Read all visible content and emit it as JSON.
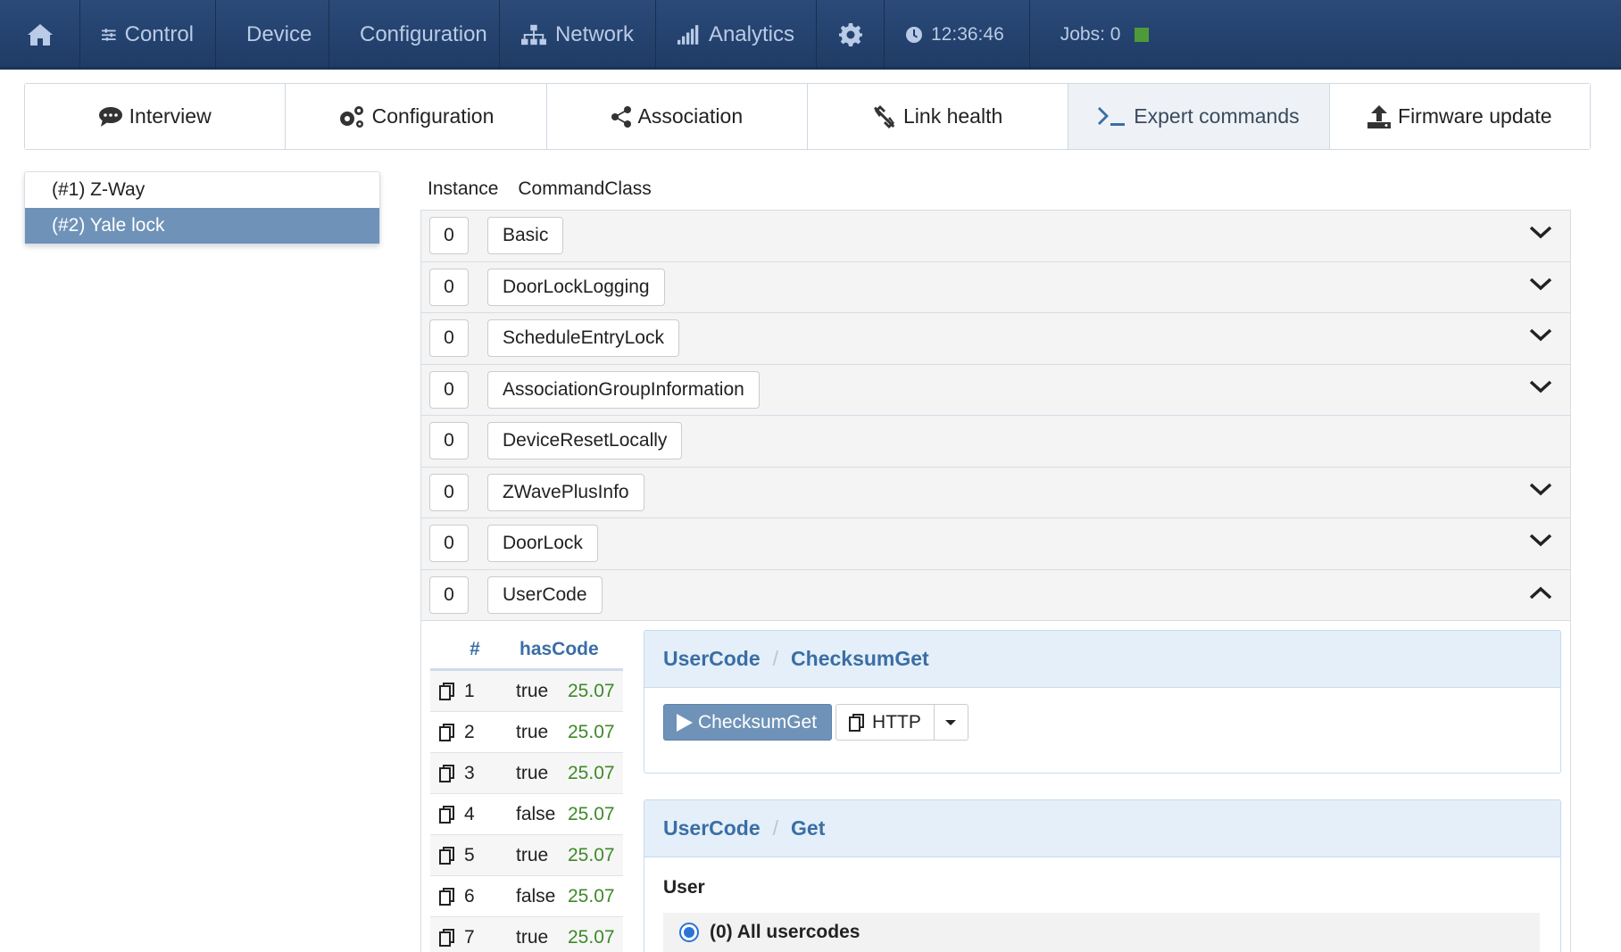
{
  "topbar": {
    "home_icon": "home-icon",
    "items": [
      {
        "label": "Control",
        "icon": "sliders-icon"
      },
      {
        "label": "Device",
        "icon": "database-icon"
      },
      {
        "label": "Configuration",
        "icon": "wrench-icon"
      },
      {
        "label": "Network",
        "icon": "sitemap-icon"
      },
      {
        "label": "Analytics",
        "icon": "signal-icon"
      }
    ],
    "settings_icon": "gear-icon",
    "time": "12:36:46",
    "jobs": "Jobs: 0",
    "jobs_status_color": "#4e9a3a"
  },
  "tabs": [
    {
      "label": "Interview",
      "icon": "comment-icon"
    },
    {
      "label": "Configuration",
      "icon": "cogs-icon"
    },
    {
      "label": "Association",
      "icon": "share-icon"
    },
    {
      "label": "Link health",
      "icon": "unlink-icon"
    },
    {
      "label": "Expert commands",
      "icon": "terminal-icon",
      "active": true
    },
    {
      "label": "Firmware update",
      "icon": "upload-icon"
    }
  ],
  "devices": [
    {
      "label": "(#1) Z-Way",
      "selected": false
    },
    {
      "label": "(#2) Yale lock",
      "selected": true
    }
  ],
  "command_header": {
    "instance": "Instance",
    "command_class": "CommandClass"
  },
  "command_classes": [
    {
      "instance": "0",
      "name": "Basic"
    },
    {
      "instance": "0",
      "name": "DoorLockLogging"
    },
    {
      "instance": "0",
      "name": "ScheduleEntryLock"
    },
    {
      "instance": "0",
      "name": "AssociationGroupInformation"
    },
    {
      "instance": "0",
      "name": "DeviceResetLocally"
    },
    {
      "instance": "0",
      "name": "ZWavePlusInfo"
    },
    {
      "instance": "0",
      "name": "DoorLock"
    },
    {
      "instance": "0",
      "name": "UserCode"
    }
  ],
  "user_codes": {
    "headers": {
      "num": "#",
      "has_code": "hasCode"
    },
    "rows": [
      {
        "num": "1",
        "has_code": "true",
        "ts": "25.07"
      },
      {
        "num": "2",
        "has_code": "true",
        "ts": "25.07"
      },
      {
        "num": "3",
        "has_code": "true",
        "ts": "25.07"
      },
      {
        "num": "4",
        "has_code": "false",
        "ts": "25.07"
      },
      {
        "num": "5",
        "has_code": "true",
        "ts": "25.07"
      },
      {
        "num": "6",
        "has_code": "false",
        "ts": "25.07"
      },
      {
        "num": "7",
        "has_code": "true",
        "ts": "25.07"
      }
    ]
  },
  "card_checksum": {
    "class": "UserCode",
    "sep": "/",
    "command": "ChecksumGet",
    "run_label": "ChecksumGet",
    "http_label": "HTTP"
  },
  "card_get": {
    "class": "UserCode",
    "sep": "/",
    "command": "Get",
    "field_label": "User",
    "option_label": "(0) All usercodes"
  }
}
